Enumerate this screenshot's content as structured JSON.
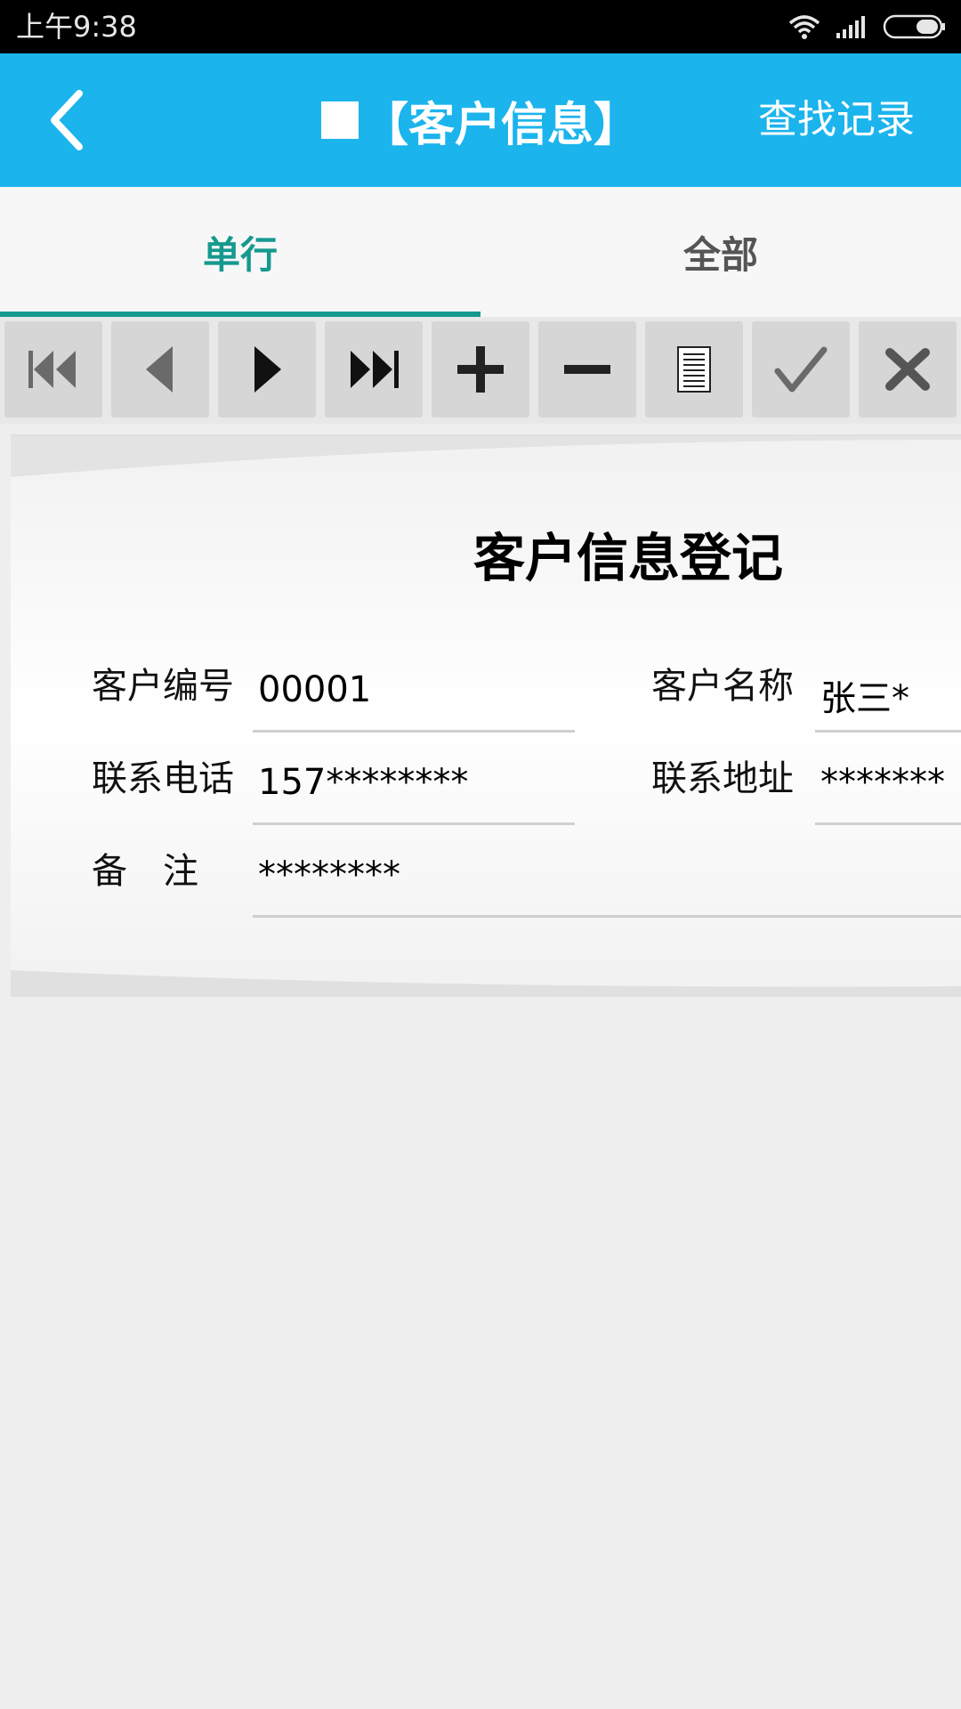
{
  "status_bar": {
    "time": "上午9:38"
  },
  "header": {
    "title": "【客户信息】",
    "find_label": "查找记录",
    "accent_color": "#1bb4ec"
  },
  "tabs": [
    {
      "label": "单行",
      "active": true
    },
    {
      "label": "全部",
      "active": false
    }
  ],
  "toolbar": {
    "buttons": [
      {
        "icon": "first-record-icon"
      },
      {
        "icon": "previous-record-icon"
      },
      {
        "icon": "next-record-icon"
      },
      {
        "icon": "last-record-icon"
      },
      {
        "icon": "add-icon"
      },
      {
        "icon": "delete-icon"
      },
      {
        "icon": "document-icon"
      },
      {
        "icon": "confirm-icon"
      },
      {
        "icon": "cancel-icon"
      }
    ]
  },
  "form": {
    "title": "客户信息登记",
    "fields": {
      "customer_id": {
        "label": "客户编号",
        "value": "00001"
      },
      "customer_name": {
        "label": "客户名称",
        "value": "张三*"
      },
      "phone": {
        "label": "联系电话",
        "value": "157********"
      },
      "address": {
        "label": "联系地址",
        "value": "*******"
      },
      "remark": {
        "label": "备　注",
        "value": "********"
      }
    }
  }
}
